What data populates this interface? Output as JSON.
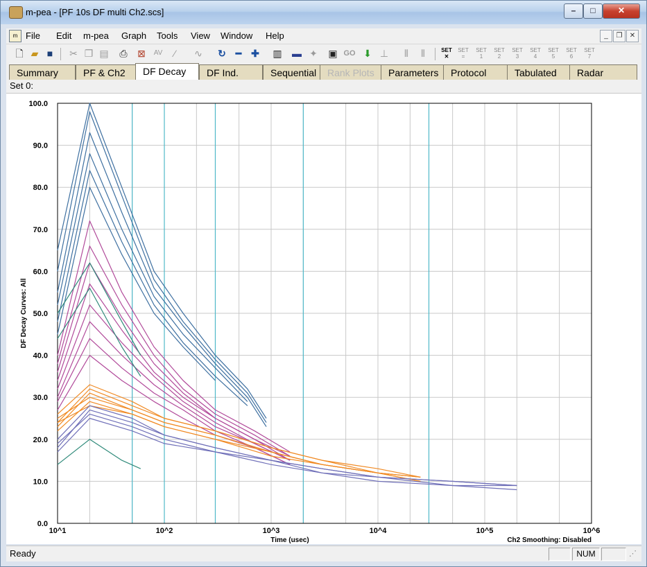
{
  "window": {
    "title": "m-pea - [PF 10s DF multi Ch2.scs]"
  },
  "menu": [
    "File",
    "Edit",
    "m-pea",
    "Graph",
    "Tools",
    "View",
    "Window",
    "Help"
  ],
  "tabs": [
    {
      "label": "Summary",
      "state": "normal"
    },
    {
      "label": "PF & Ch2",
      "state": "normal"
    },
    {
      "label": "DF Decay",
      "state": "active"
    },
    {
      "label": "DF Ind.",
      "state": "normal"
    },
    {
      "label": "Sequential",
      "state": "normal"
    },
    {
      "label": "Rank Plots",
      "state": "disabled"
    },
    {
      "label": "Parameters",
      "state": "normal"
    },
    {
      "label": "Protocol",
      "state": "normal"
    },
    {
      "label": "Tabulated",
      "state": "normal"
    },
    {
      "label": "Radar",
      "state": "normal"
    }
  ],
  "toolbar": {
    "set_labels": [
      "SET",
      "SET",
      "SET",
      "SET",
      "SET",
      "SET",
      "SET",
      "SET"
    ],
    "set_numbers": [
      "=",
      "1",
      "2",
      "3",
      "4",
      "5",
      "6",
      "7"
    ],
    "go_label": "GO"
  },
  "set_line": "Set 0:",
  "status": {
    "text": "Ready",
    "num": "NUM"
  },
  "colors": {
    "blue_series": "#3d6fa0",
    "magenta_series": "#b14a9a",
    "orange_series": "#f08a24",
    "purple_series": "#6f6fb8",
    "green_series": "#2f8a7a",
    "grid_major": "#4fb9c9",
    "grid_minor": "#c8c8c8"
  },
  "chart_data": {
    "type": "line",
    "ylabel": "DF Decay Curves: All",
    "xlabel": "Time (usec)",
    "annotation": "Ch2 Smoothing: Disabled",
    "x_scale": "log",
    "xlim": [
      10,
      1000000
    ],
    "ylim": [
      0,
      100
    ],
    "x_tick_labels": [
      "10^1",
      "10^2",
      "10^3",
      "10^4",
      "10^5",
      "10^6"
    ],
    "y_tick_labels": [
      "0.0",
      "10.0",
      "20.0",
      "30.0",
      "40.0",
      "50.0",
      "60.0",
      "70.0",
      "80.0",
      "90.0",
      "100.0"
    ],
    "grid": true,
    "series": [
      {
        "group": "blue",
        "color": "#3d6fa0",
        "x": [
          10,
          20,
          40,
          80,
          150,
          300,
          600,
          900
        ],
        "y": [
          65,
          100,
          80,
          60,
          50,
          40,
          32,
          25
        ]
      },
      {
        "group": "blue",
        "color": "#3d6fa0",
        "x": [
          10,
          20,
          40,
          80,
          150,
          300,
          600,
          900
        ],
        "y": [
          60,
          98,
          78,
          58,
          48,
          39,
          31,
          24
        ]
      },
      {
        "group": "blue",
        "color": "#3d6fa0",
        "x": [
          10,
          20,
          40,
          80,
          150,
          300,
          600,
          900
        ],
        "y": [
          55,
          93,
          74,
          56,
          47,
          38,
          30,
          23
        ]
      },
      {
        "group": "blue",
        "color": "#3d6fa0",
        "x": [
          10,
          20,
          40,
          80,
          150,
          300,
          600
        ],
        "y": [
          52,
          88,
          70,
          54,
          45,
          37,
          29
        ]
      },
      {
        "group": "blue",
        "color": "#3d6fa0",
        "x": [
          10,
          20,
          40,
          80,
          150,
          300,
          600
        ],
        "y": [
          48,
          84,
          67,
          52,
          43,
          35,
          28
        ]
      },
      {
        "group": "blue",
        "color": "#3d6fa0",
        "x": [
          10,
          20,
          40,
          80,
          150,
          300
        ],
        "y": [
          45,
          80,
          64,
          50,
          42,
          34
        ]
      },
      {
        "group": "magenta",
        "color": "#b14a9a",
        "x": [
          10,
          20,
          40,
          80,
          150,
          300,
          700,
          1500
        ],
        "y": [
          40,
          72,
          55,
          42,
          34,
          27,
          22,
          17
        ]
      },
      {
        "group": "magenta",
        "color": "#b14a9a",
        "x": [
          10,
          20,
          40,
          80,
          150,
          300,
          700,
          1500
        ],
        "y": [
          38,
          66,
          52,
          40,
          32,
          26,
          21,
          16
        ]
      },
      {
        "group": "magenta",
        "color": "#b14a9a",
        "x": [
          10,
          20,
          40,
          80,
          150,
          300,
          700,
          1500
        ],
        "y": [
          36,
          62,
          49,
          38,
          31,
          25,
          20,
          16
        ]
      },
      {
        "group": "magenta",
        "color": "#b14a9a",
        "x": [
          10,
          20,
          40,
          80,
          150,
          300,
          700,
          1500
        ],
        "y": [
          34,
          57,
          46,
          36,
          30,
          25,
          20,
          15
        ]
      },
      {
        "group": "magenta",
        "color": "#b14a9a",
        "x": [
          10,
          20,
          40,
          80,
          150,
          300,
          700,
          1500
        ],
        "y": [
          32,
          52,
          43,
          35,
          29,
          24,
          19,
          15
        ]
      },
      {
        "group": "magenta",
        "color": "#b14a9a",
        "x": [
          10,
          20,
          40,
          80,
          150,
          300,
          700,
          1500
        ],
        "y": [
          30,
          48,
          40,
          33,
          28,
          23,
          19,
          15
        ]
      },
      {
        "group": "magenta",
        "color": "#b14a9a",
        "x": [
          10,
          20,
          40,
          80,
          150,
          300,
          700,
          1500
        ],
        "y": [
          29,
          44,
          37,
          31,
          27,
          22,
          18,
          14
        ]
      },
      {
        "group": "magenta",
        "color": "#b14a9a",
        "x": [
          10,
          20,
          40,
          80,
          150,
          300,
          700,
          1500
        ],
        "y": [
          27,
          40,
          34,
          29,
          25,
          21,
          18,
          14
        ]
      },
      {
        "group": "green",
        "color": "#2f8a7a",
        "x": [
          10,
          20,
          40,
          60
        ],
        "y": [
          50,
          62,
          48,
          40
        ]
      },
      {
        "group": "green",
        "color": "#2f8a7a",
        "x": [
          10,
          20,
          40,
          60
        ],
        "y": [
          44,
          56,
          42,
          35
        ]
      },
      {
        "group": "green",
        "color": "#2f8a7a",
        "x": [
          10,
          20,
          40,
          60
        ],
        "y": [
          14,
          20,
          15,
          13
        ]
      },
      {
        "group": "orange",
        "color": "#f08a24",
        "x": [
          10,
          20,
          50,
          100,
          300,
          1000,
          3000,
          10000,
          25000
        ],
        "y": [
          23,
          31,
          27,
          24,
          21,
          17,
          14,
          12,
          11
        ]
      },
      {
        "group": "orange",
        "color": "#f08a24",
        "x": [
          10,
          20,
          50,
          100,
          300,
          1000,
          3000,
          10000,
          25000
        ],
        "y": [
          24,
          32,
          28,
          25,
          22,
          18,
          15,
          12,
          11
        ]
      },
      {
        "group": "orange",
        "color": "#f08a24",
        "x": [
          10,
          20,
          50,
          100,
          300,
          1000,
          3000,
          10000,
          25000
        ],
        "y": [
          25,
          30,
          27,
          24,
          21,
          17,
          14,
          12,
          10
        ]
      },
      {
        "group": "orange",
        "color": "#f08a24",
        "x": [
          10,
          20,
          50,
          100,
          300,
          1000,
          3000,
          10000,
          25000
        ],
        "y": [
          22,
          29,
          26,
          23,
          20,
          16,
          14,
          12,
          11
        ]
      },
      {
        "group": "orange",
        "color": "#f08a24",
        "x": [
          10,
          20,
          50,
          100,
          300,
          1000,
          3000,
          10000,
          25000
        ],
        "y": [
          26,
          33,
          29,
          25,
          22,
          18,
          15,
          13,
          11
        ]
      },
      {
        "group": "orange",
        "color": "#f08a24",
        "x": [
          10,
          20,
          50,
          100,
          300,
          1000,
          3000,
          10000,
          25000
        ],
        "y": [
          24,
          28,
          26,
          23,
          20,
          17,
          14,
          12,
          10
        ]
      },
      {
        "group": "purple",
        "color": "#6f6fb8",
        "x": [
          10,
          20,
          50,
          100,
          300,
          1000,
          3000,
          10000,
          50000,
          200000
        ],
        "y": [
          18,
          27,
          24,
          21,
          18,
          15,
          13,
          11,
          10,
          9
        ]
      },
      {
        "group": "purple",
        "color": "#6f6fb8",
        "x": [
          10,
          20,
          50,
          100,
          300,
          1000,
          3000,
          10000,
          50000,
          200000
        ],
        "y": [
          19,
          26,
          23,
          20,
          17,
          15,
          12,
          11,
          10,
          9
        ]
      },
      {
        "group": "purple",
        "color": "#6f6fb8",
        "x": [
          10,
          20,
          50,
          100,
          300,
          1000,
          3000,
          10000,
          50000,
          200000
        ],
        "y": [
          20,
          28,
          25,
          21,
          18,
          15,
          13,
          11,
          9,
          9
        ]
      },
      {
        "group": "purple",
        "color": "#6f6fb8",
        "x": [
          10,
          20,
          50,
          100,
          300,
          1000,
          3000,
          10000,
          50000,
          200000
        ],
        "y": [
          17,
          25,
          22,
          19,
          17,
          14,
          12,
          10,
          9,
          8
        ]
      }
    ]
  }
}
